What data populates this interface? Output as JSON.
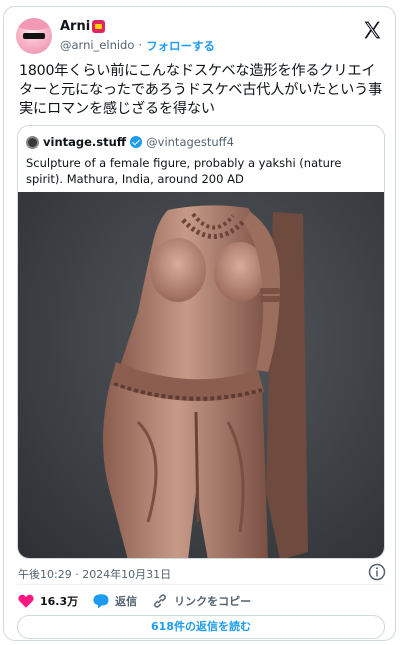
{
  "author": {
    "display_name": "Arni",
    "handle": "@arni_elnido",
    "separator": "·",
    "follow_label": "フォローする"
  },
  "tweet": {
    "text": "1800年くらい前にこんなドスケベな造形を作るクリエイターと元になったであろうドスケベ古代人がいたという事実にロマンを感じざるを得ない"
  },
  "quote": {
    "display_name": "vintage.stuff",
    "handle": "@vintagestuff4",
    "text": "Sculpture of a female figure, probably a yakshi (nature spirit). Mathura, India, around 200 AD"
  },
  "meta": {
    "timestamp": "午後10:29 · 2024年10月31日"
  },
  "actions": {
    "likes": "16.3万",
    "reply_label": "返信",
    "copy_link_label": "リンクをコピー"
  },
  "read_replies_label": "618件の返信を読む",
  "colors": {
    "accent": "#1d9bf0",
    "like": "#f91880",
    "text": "#0f1419",
    "muted": "#536471",
    "border": "#cfd9de"
  },
  "icons": [
    "x-logo-icon",
    "verified-badge-icon",
    "info-icon",
    "heart-icon",
    "reply-bubble-icon",
    "link-icon"
  ]
}
